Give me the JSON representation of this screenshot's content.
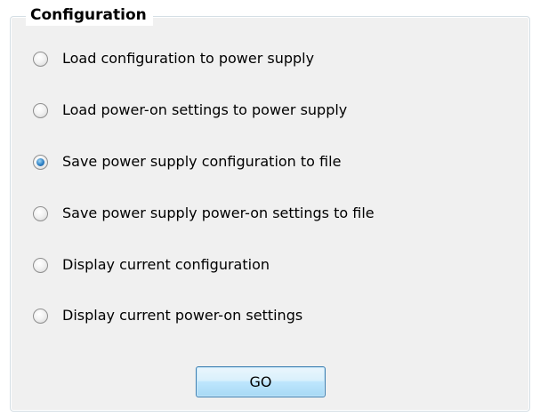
{
  "group": {
    "title": "Configuration"
  },
  "options": [
    {
      "label": "Load configuration to power supply",
      "checked": false
    },
    {
      "label": "Load power-on settings to power supply",
      "checked": false
    },
    {
      "label": "Save power supply configuration to file",
      "checked": true
    },
    {
      "label": "Save power supply power-on settings to file",
      "checked": false
    },
    {
      "label": "Display current configuration",
      "checked": false
    },
    {
      "label": "Display current power-on settings",
      "checked": false
    }
  ],
  "go_button": {
    "label": "GO"
  }
}
